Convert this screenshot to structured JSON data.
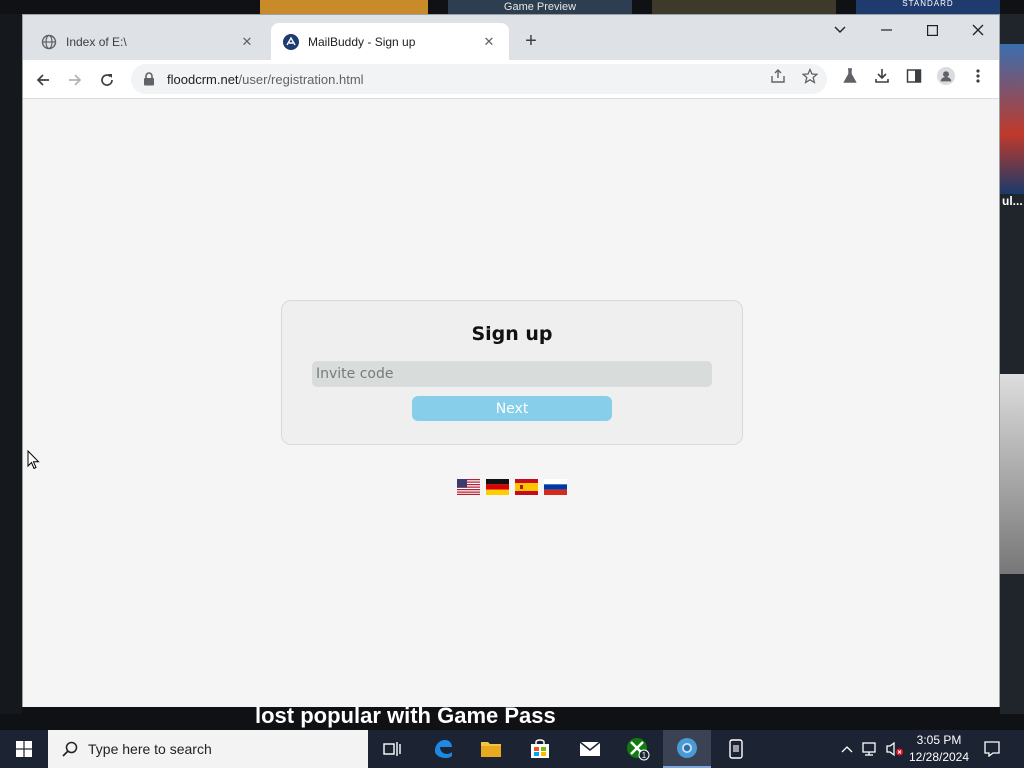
{
  "background": {
    "tile_label": "Game Preview",
    "tile_corner_label": "STANDARD",
    "right_label": "ul...",
    "banner": "lost popular with Game Pass"
  },
  "browser": {
    "tabs": [
      {
        "title": "Index of E:\\",
        "active": false
      },
      {
        "title": "MailBuddy - Sign up",
        "active": true
      }
    ],
    "new_tab_label": "+",
    "address": {
      "host": "floodcrm.net",
      "path": "/user/registration.html"
    }
  },
  "page": {
    "heading": "Sign up",
    "invite_placeholder": "Invite code",
    "invite_value": "",
    "next_label": "Next",
    "languages": [
      "English",
      "German",
      "Spanish",
      "Russian"
    ]
  },
  "taskbar": {
    "search_placeholder": "Type here to search",
    "xbox_badge": "1",
    "time": "3:05 PM",
    "date": "12/28/2024"
  },
  "colors": {
    "primary_button": "#87ceeb",
    "page_background": "#f5f5f5",
    "taskbar": "#1c2333"
  }
}
